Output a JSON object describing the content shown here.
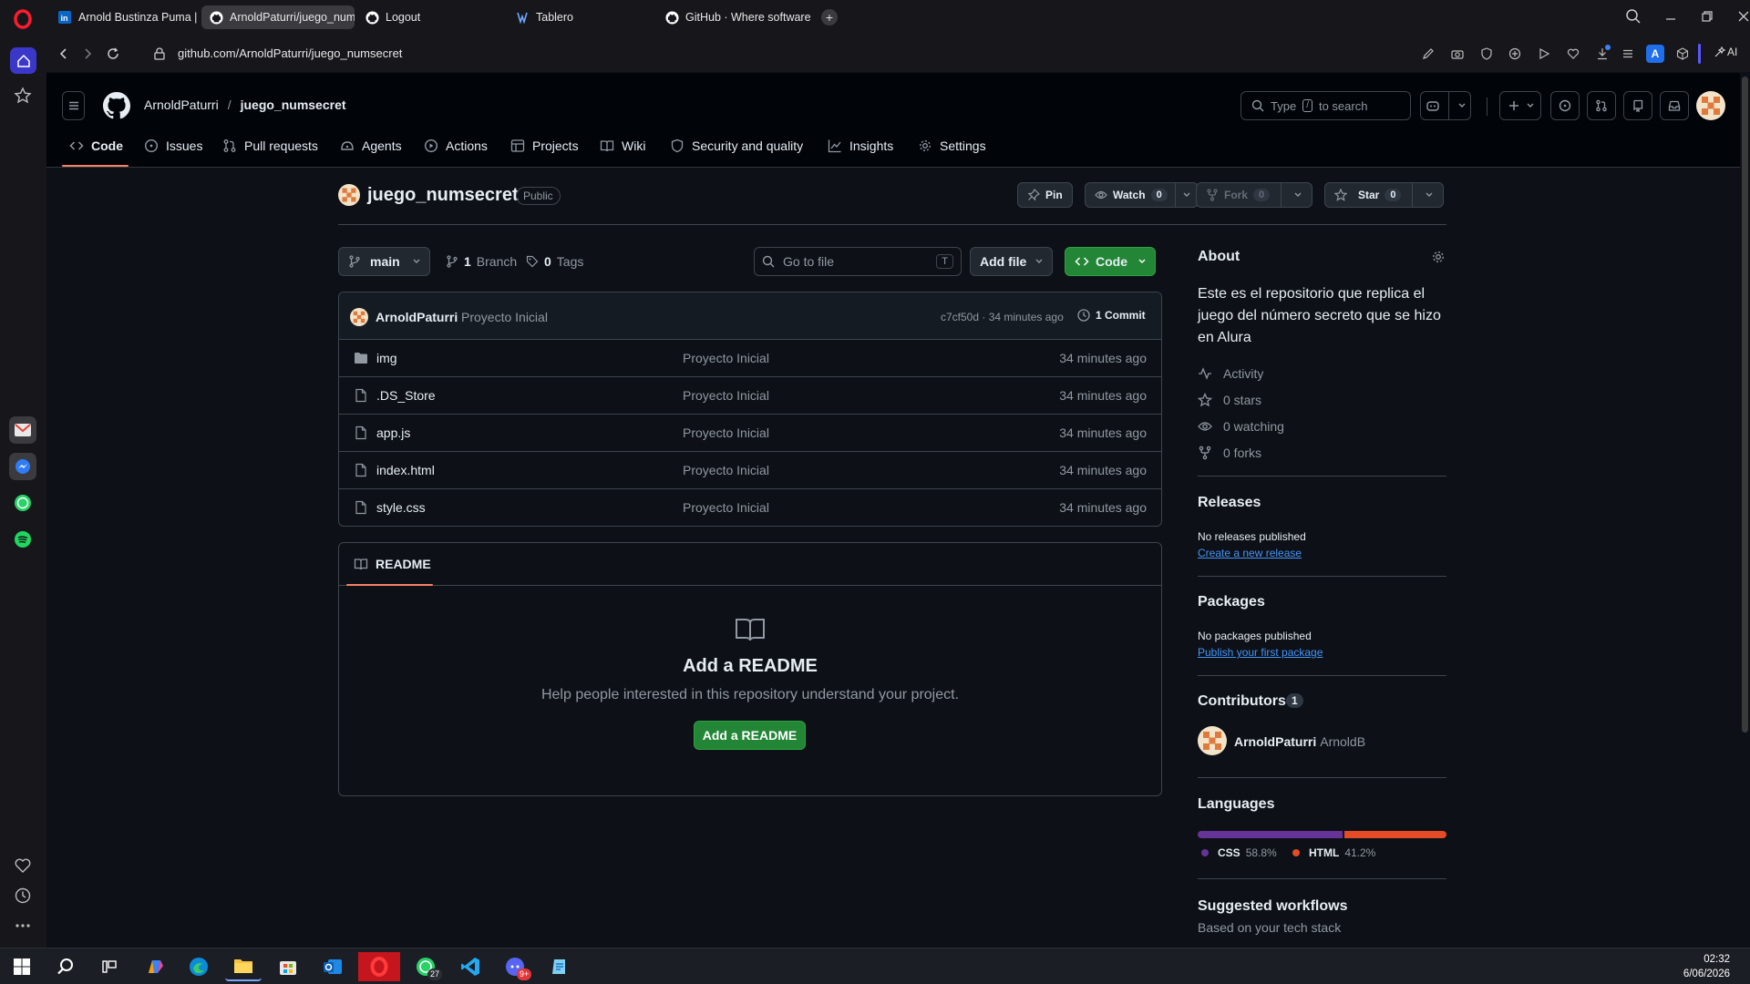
{
  "browser": {
    "tabs": [
      {
        "label": "Arnold Bustinza Puma | Lin",
        "icon": "linkedin-icon",
        "active": false
      },
      {
        "label": "ArnoldPaturri/juego_num",
        "icon": "github-icon",
        "active": true
      },
      {
        "label": "Logout",
        "icon": "github-icon",
        "active": false
      },
      {
        "label": "Tablero",
        "icon": "trello-icon",
        "active": false
      },
      {
        "label": "GitHub · Where software i",
        "icon": "github-icon",
        "active": false
      }
    ],
    "url": "github.com/ArnoldPaturri/juego_numsecret",
    "profile_initial": "A",
    "ai_label": "AI"
  },
  "header": {
    "owner": "ArnoldPaturri",
    "separator": "/",
    "repo": "juego_numsecret",
    "search_placeholder_pre": "Type",
    "search_key": "/",
    "search_placeholder_post": "to search"
  },
  "nav": {
    "tabs": [
      {
        "label": "Code",
        "icon": "code-icon"
      },
      {
        "label": "Issues",
        "icon": "issue-icon"
      },
      {
        "label": "Pull requests",
        "icon": "pull-request-icon"
      },
      {
        "label": "Agents",
        "icon": "agents-icon"
      },
      {
        "label": "Actions",
        "icon": "play-icon"
      },
      {
        "label": "Projects",
        "icon": "table-icon"
      },
      {
        "label": "Wiki",
        "icon": "book-icon"
      },
      {
        "label": "Security and quality",
        "icon": "shield-icon"
      },
      {
        "label": "Insights",
        "icon": "graph-icon"
      },
      {
        "label": "Settings",
        "icon": "gear-icon"
      }
    ]
  },
  "repo": {
    "name": "juego_numsecret",
    "visibility": "Public",
    "pin_label": "Pin",
    "watch_label": "Watch",
    "watch_count": "0",
    "fork_label": "Fork",
    "fork_count": "0",
    "star_label": "Star",
    "star_count": "0"
  },
  "toolbar": {
    "branch": "main",
    "branches_count": "1",
    "branches_label": "Branch",
    "tags_count": "0",
    "tags_label": "Tags",
    "goto_placeholder": "Go to file",
    "goto_key": "T",
    "add_file": "Add file",
    "code_button": "Code"
  },
  "commit": {
    "author": "ArnoldPaturri",
    "message": "Proyecto Inicial",
    "hash_time": "c7cf50d · 34 minutes ago",
    "commits_label": "1 Commit"
  },
  "files": [
    {
      "name": "img",
      "type": "folder",
      "message": "Proyecto Inicial",
      "date": "34 minutes ago"
    },
    {
      "name": ".DS_Store",
      "type": "file",
      "message": "Proyecto Inicial",
      "date": "34 minutes ago"
    },
    {
      "name": "app.js",
      "type": "file",
      "message": "Proyecto Inicial",
      "date": "34 minutes ago"
    },
    {
      "name": "index.html",
      "type": "file",
      "message": "Proyecto Inicial",
      "date": "34 minutes ago"
    },
    {
      "name": "style.css",
      "type": "file",
      "message": "Proyecto Inicial",
      "date": "34 minutes ago"
    }
  ],
  "readme": {
    "tab_label": "README",
    "title": "Add a README",
    "subtitle": "Help people interested in this repository understand your project.",
    "button": "Add a README"
  },
  "about": {
    "heading": "About",
    "description": "Este es el repositorio que replica el juego del número secreto que se hizo en Alura",
    "activity": "Activity",
    "stars": "0 stars",
    "watching": "0 watching",
    "forks": "0 forks"
  },
  "releases": {
    "heading": "Releases",
    "empty": "No releases published",
    "link": "Create a new release"
  },
  "packages": {
    "heading": "Packages",
    "empty": "No packages published",
    "link": "Publish your first package"
  },
  "contributors": {
    "heading": "Contributors",
    "count": "1",
    "name": "ArnoldPaturri",
    "handle": "ArnoldB"
  },
  "languages": {
    "heading": "Languages",
    "items": [
      {
        "name": "CSS",
        "percent": "58.8%",
        "value": 58.8,
        "color": "#663399"
      },
      {
        "name": "HTML",
        "percent": "41.2%",
        "value": 41.2,
        "color": "#e34c26"
      }
    ]
  },
  "workflows": {
    "heading": "Suggested workflows",
    "subtitle": "Based on your tech stack"
  },
  "taskbar": {
    "time": "02:32",
    "date": "6/06/2026",
    "whatsapp_badge": "27",
    "discord_badge": "9+"
  },
  "colors": {
    "accent_green": "#238636",
    "link_blue": "#4493f8",
    "underline": "#f78166"
  }
}
